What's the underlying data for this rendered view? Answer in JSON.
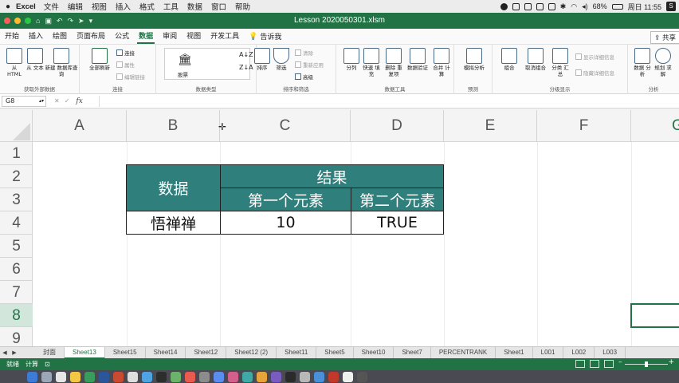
{
  "menubar": {
    "app_name": "Excel",
    "items": [
      "文件",
      "编辑",
      "视图",
      "插入",
      "格式",
      "工具",
      "数据",
      "窗口",
      "帮助"
    ],
    "battery": "68%",
    "clock": "周日 11:55",
    "s_icon": "S"
  },
  "window": {
    "title": "Lesson 2020050301.xlsm"
  },
  "ribbon_tabs": [
    "开始",
    "插入",
    "绘图",
    "页面布局",
    "公式",
    "数据",
    "审阅",
    "视图",
    "开发工具"
  ],
  "active_tab": "数据",
  "tell_me": "告诉我",
  "share_label": "共享",
  "ribbon": {
    "get_data": {
      "html": "从 HTML",
      "text": "从 文本",
      "newq": "新建 数据库查询",
      "caption": "获取外部数据"
    },
    "connections": {
      "refresh": "全部刷新",
      "connect": "连接",
      "props": "属性",
      "edit_links": "编辑链接",
      "caption": "连接"
    },
    "data_types": {
      "stocks": "股票",
      "caption": "数据类型"
    },
    "sort_filter": {
      "sort": "排序",
      "filter": "筛选",
      "clear": "清除",
      "reapply": "重新应用",
      "advanced": "高级",
      "caption": "排序和筛选"
    },
    "data_tools": {
      "split": "分列",
      "flash": "快速 填充",
      "remove_dup": "删除 重复项",
      "validate": "数据验证",
      "merge": "合并 计算",
      "caption": "数据工具"
    },
    "forecast": {
      "whatif": "模拟分析",
      "caption": "预测"
    },
    "outline": {
      "group": "组合",
      "ungroup": "取消组合",
      "subtotal": "分类 汇总",
      "show_detail": "显示详细信息",
      "hide_detail": "隐藏详细信息",
      "caption": "分级显示"
    },
    "analysis": {
      "data_analysis": "数据 分析",
      "solver": "规划 求解",
      "caption": "分析"
    }
  },
  "formula_bar": {
    "name_box": "G8",
    "fx": "fx",
    "formula": ""
  },
  "columns": [
    "A",
    "B",
    "C",
    "D",
    "E",
    "F",
    "G"
  ],
  "rows": [
    "1",
    "2",
    "3",
    "4",
    "5",
    "6",
    "7",
    "8",
    "9"
  ],
  "selected_cell": "G8",
  "table": {
    "header_data": "数据",
    "header_result": "结果",
    "sub_first": "第一个元素",
    "sub_second": "第二个元素",
    "row_label": "悟禅禅",
    "value_first": "10",
    "value_second": "TRUE",
    "header_fill": "#2f7f7c"
  },
  "sheet_tabs": [
    "封面",
    "Sheet13",
    "Sheet15",
    "Sheet14",
    "Sheet12",
    "Sheet12 (2)",
    "Sheet11",
    "Sheet5",
    "Sheet10",
    "Sheet7",
    "PERCENTRANK",
    "Sheet1",
    "L001",
    "L002",
    "L003"
  ],
  "active_sheet": "Sheet13",
  "status": {
    "ready": "就绪",
    "calc": "计算"
  },
  "accent_color": "#217346"
}
